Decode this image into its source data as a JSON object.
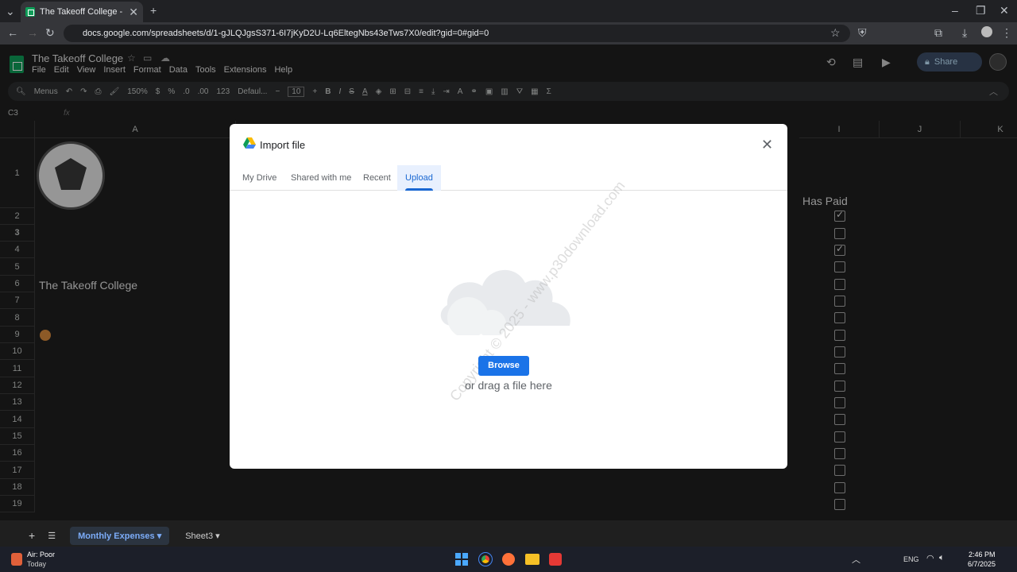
{
  "browser": {
    "tab_title": "The Takeoff College - Google Sh",
    "url": "docs.google.com/spreadsheets/d/1-gJLQJgsS371-6I7jKyD2U-Lq6EltegNbs43eTws7X0/edit?gid=0#gid=0"
  },
  "sheets": {
    "doc_title": "The Takeoff College",
    "menus": [
      "File",
      "Edit",
      "View",
      "Insert",
      "Format",
      "Data",
      "Tools",
      "Extensions",
      "Help"
    ],
    "share_label": "Share",
    "toolbar": {
      "menus": "Menus",
      "zoom": "150%",
      "currency": "$",
      "percent": "%",
      "dec_less": ".0",
      "dec_more": ".00",
      "format_123": "123",
      "font": "Defaul...",
      "font_size": "10"
    },
    "name_box": "C3",
    "columns": [
      "A",
      "I",
      "J",
      "K"
    ],
    "rows": [
      "1",
      "2",
      "3",
      "4",
      "5",
      "6",
      "7",
      "8",
      "9",
      "10",
      "11",
      "12",
      "13",
      "14",
      "15",
      "16",
      "17",
      "18",
      "19"
    ],
    "cell_a6": "The Takeoff College",
    "has_paid_header": "Has Paid",
    "checked_rows": [
      2,
      4
    ],
    "sheet_tabs": [
      "Monthly Expenses",
      "Sheet3"
    ]
  },
  "dialog": {
    "title": "Import file",
    "tabs": [
      "My Drive",
      "Shared with me",
      "Recent",
      "Upload"
    ],
    "active_tab": "Upload",
    "browse_label": "Browse",
    "drag_text": "or drag a file here",
    "watermark": "Copyright © 2025 - www.p30download.com"
  },
  "taskbar": {
    "weather_title": "Air: Poor",
    "weather_sub": "Today",
    "lang": "ENG",
    "time": "2:46 PM",
    "date": "6/7/2025"
  },
  "colors": {
    "accent": "#1a73e8",
    "dialog_bg": "#ffffff",
    "dark_bg": "#1f1f1f"
  }
}
